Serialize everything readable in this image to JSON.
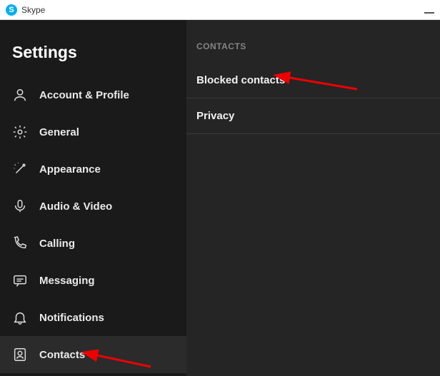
{
  "titlebar": {
    "app_name": "Skype"
  },
  "sidebar": {
    "title": "Settings",
    "items": [
      {
        "label": "Account & Profile"
      },
      {
        "label": "General"
      },
      {
        "label": "Appearance"
      },
      {
        "label": "Audio & Video"
      },
      {
        "label": "Calling"
      },
      {
        "label": "Messaging"
      },
      {
        "label": "Notifications"
      },
      {
        "label": "Contacts"
      }
    ]
  },
  "main": {
    "section_header": "CONTACTS",
    "items": [
      {
        "label": "Blocked contacts"
      },
      {
        "label": "Privacy"
      }
    ]
  }
}
